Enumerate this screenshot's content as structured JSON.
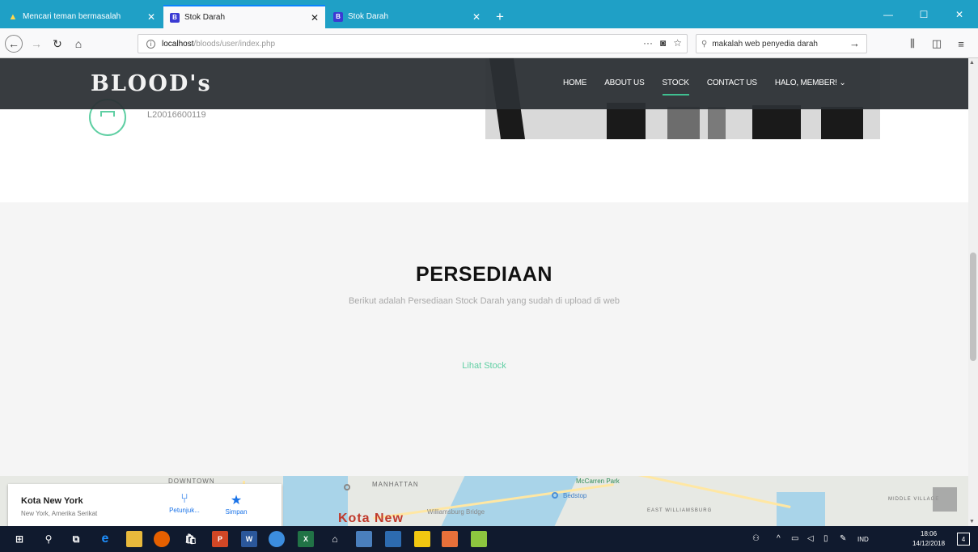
{
  "browser": {
    "tabs": [
      {
        "title": "Mencari teman bermasalah",
        "favicon": "warning-icon",
        "active": false
      },
      {
        "title": "Stok Darah",
        "favicon": "b-icon",
        "active": true
      },
      {
        "title": "Stok Darah",
        "favicon": "b-icon",
        "active": false
      }
    ],
    "new_tab": "+",
    "window_controls": {
      "minimize": "—",
      "maximize": "☐",
      "close": "✕"
    },
    "url": {
      "host": "localhost",
      "path": "/bloods/user/index.php"
    },
    "url_actions": {
      "more": "···",
      "pocket": "◙",
      "bookmark": "☆"
    },
    "search": {
      "value": "makalah web penyedia darah",
      "go": "→"
    },
    "toolbar_icons": {
      "library": "⫼",
      "sidebar": "◫",
      "menu": "≡"
    }
  },
  "site": {
    "logo": "BLOOD's",
    "menu": [
      {
        "label": "HOME",
        "active": false
      },
      {
        "label": "ABOUT US",
        "active": false
      },
      {
        "label": "STOCK",
        "active": true
      },
      {
        "label": "CONTACT US",
        "active": false
      },
      {
        "label": "HALO, MEMBER! ⌄",
        "active": false
      }
    ],
    "member_id": "L20016600119"
  },
  "persediaan": {
    "title": "PERSEDIAAN",
    "subtitle": "Berikut adalah Persediaan Stock Darah yang sudah di upload di web",
    "link": "Lihat Stock"
  },
  "map": {
    "card_title": "Kota New York",
    "card_subtitle": "New York, Amerika Serikat",
    "directions_label": "Petunjuk...",
    "save_label": "Simpan",
    "city_label": "Kota New",
    "labels": [
      "MANHATTAN",
      "EAST WILLIAMSBURG",
      "MIDDLE VILLAGE",
      "DOWNTOWN"
    ],
    "places": [
      "McCarren Park",
      "Bedstop",
      "Williamsburg Bridge"
    ]
  },
  "taskbar": {
    "tray_lang": "IND",
    "time": "18:06",
    "date": "14/12/2018",
    "notification_count": "4"
  },
  "colors": {
    "tab_strip": "#1fa0c6",
    "site_header": "#2c3034",
    "accent_green": "#5fcfa3",
    "taskbar": "#101a2e"
  }
}
